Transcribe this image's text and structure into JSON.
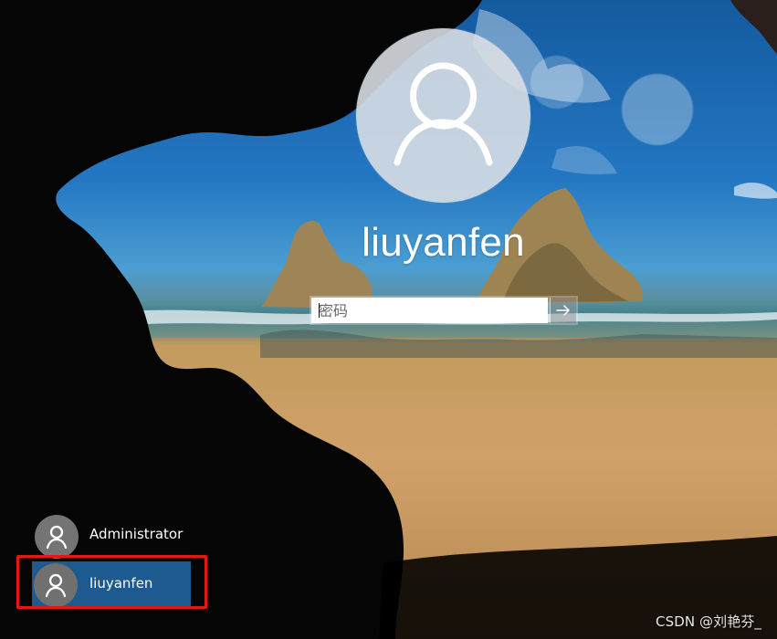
{
  "login": {
    "username": "liuyanfen",
    "password_placeholder": "密码"
  },
  "icons": {
    "large_avatar": "user-icon",
    "submit": "arrow-right-icon",
    "small_avatar": "user-icon"
  },
  "users": [
    {
      "name": "Administrator",
      "selected": false
    },
    {
      "name": "liuyanfen",
      "selected": true
    }
  ],
  "watermark": "CSDN @刘艳芬_",
  "colors": {
    "selected_user_bg": "#1c5a8f",
    "highlight_outline": "#e51616",
    "avatar_bg": "#dde0e5",
    "input_bg": "#ffffff",
    "text_white": "#ffffff"
  }
}
